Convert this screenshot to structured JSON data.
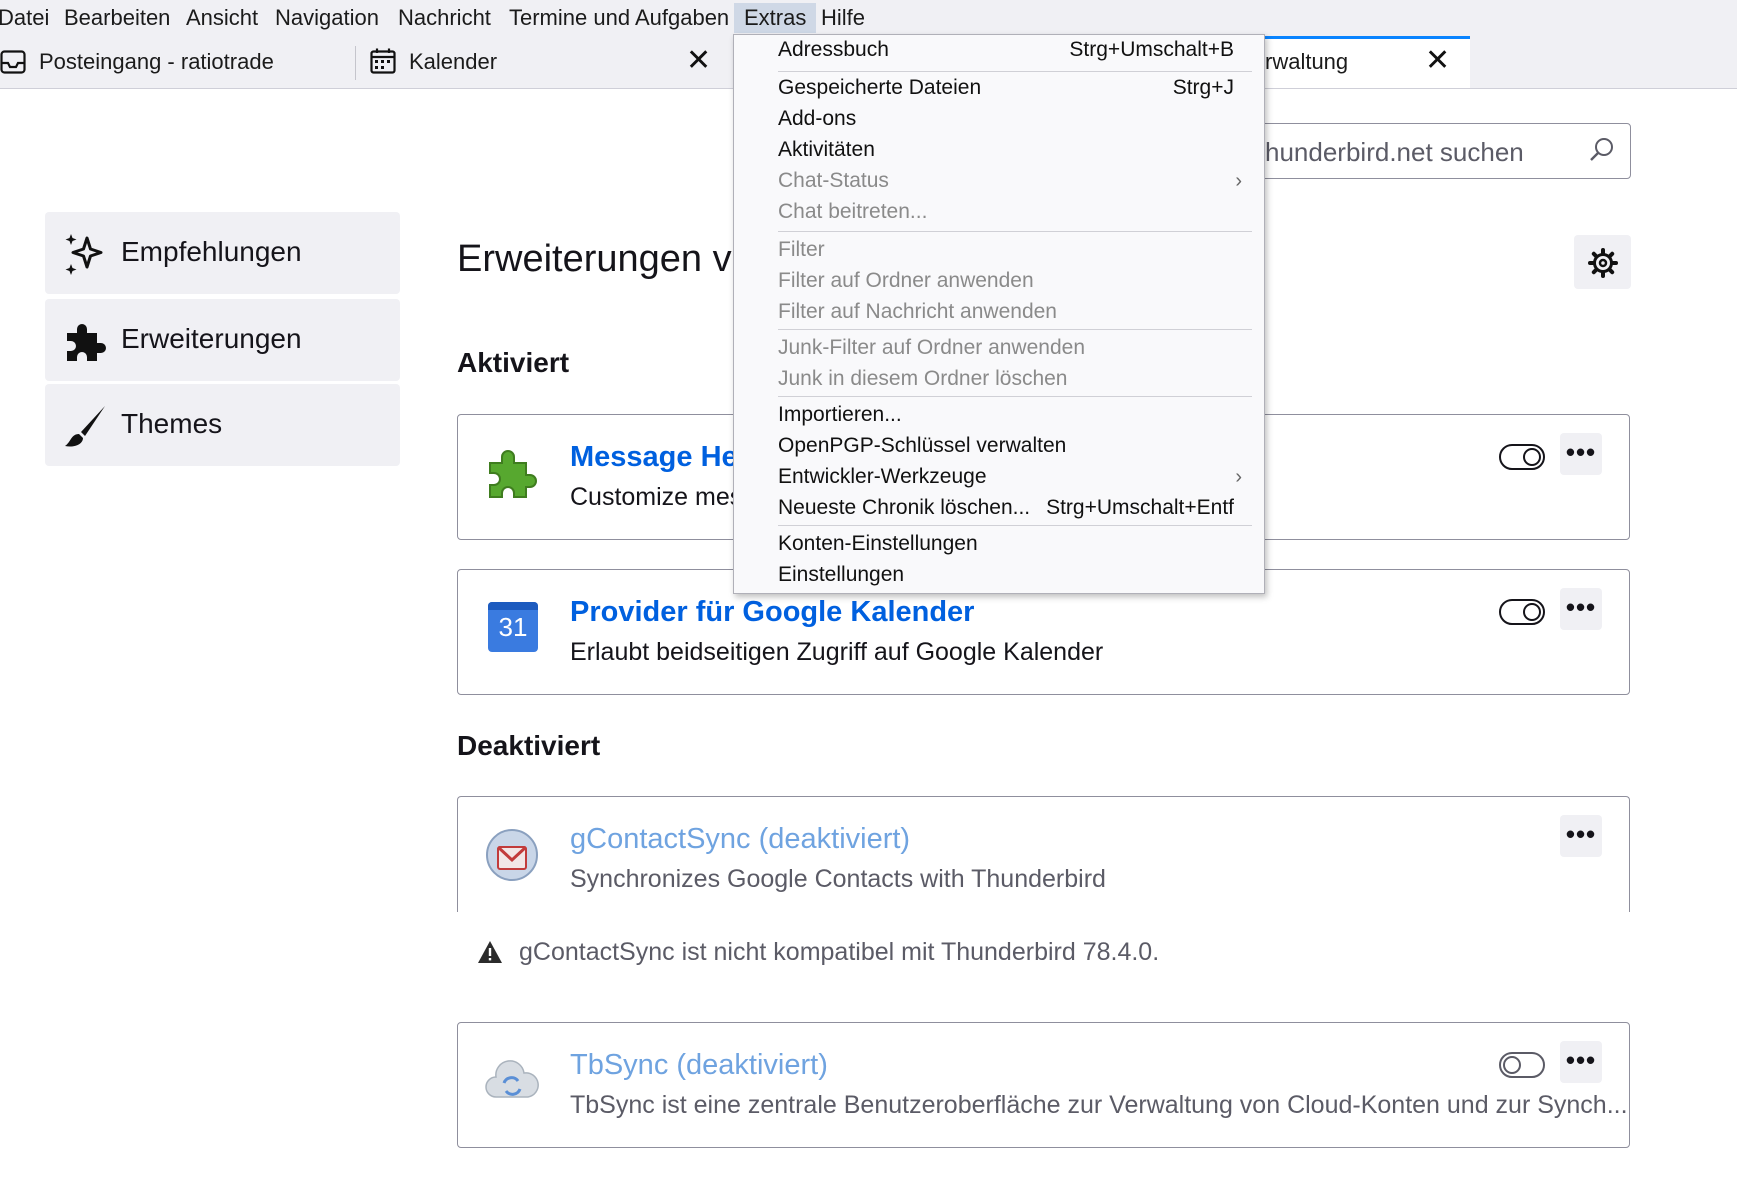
{
  "menubar": {
    "items": [
      "Datei",
      "Bearbeiten",
      "Ansicht",
      "Navigation",
      "Nachricht",
      "Termine und Aufgaben",
      "Extras",
      "Hilfe"
    ]
  },
  "tabs": [
    {
      "label": "Posteingang - ratiotrade",
      "icon": "inbox-icon"
    },
    {
      "label": "Kalender",
      "icon": "calendar-icon",
      "close": "✕"
    },
    {
      "label": "rwaltung",
      "icon": "addons-icon",
      "close": "✕"
    }
  ],
  "search": {
    "placeholder": "hunderbird.net suchen"
  },
  "sidebar": {
    "items": [
      {
        "label": "Empfehlungen",
        "icon": "sparkle-icon"
      },
      {
        "label": "Erweiterungen",
        "icon": "puzzle-icon"
      },
      {
        "label": "Themes",
        "icon": "brush-icon"
      }
    ]
  },
  "main": {
    "title": "Erweiterungen ve",
    "enabled_heading": "Aktiviert",
    "disabled_heading": "Deaktiviert",
    "more_label": "•••",
    "enabled": [
      {
        "name": "Message Hea",
        "desc": "Customize mes",
        "toggle": "on"
      },
      {
        "name": "Provider für Google Kalender",
        "desc": "Erlaubt beidseitigen Zugriff auf Google Kalender",
        "toggle": "on",
        "icon_text": "31"
      }
    ],
    "disabled": [
      {
        "name": "gContactSync (deaktiviert)",
        "desc": "Synchronizes Google Contacts with Thunderbird"
      },
      {
        "name": "TbSync (deaktiviert)",
        "desc": "TbSync ist eine zentrale Benutzeroberfläche zur Verwaltung von Cloud-Konten und zur Synch...",
        "toggle": "off"
      }
    ],
    "warning": "gContactSync ist nicht kompatibel mit Thunderbird 78.4.0."
  },
  "extras_menu": {
    "items": [
      {
        "label": "Adressbuch",
        "shortcut": "Strg+Umschalt+B",
        "enabled": true
      },
      {
        "label": "Gespeicherte Dateien",
        "shortcut": "Strg+J",
        "enabled": true
      },
      {
        "label": "Add-ons",
        "enabled": true
      },
      {
        "label": "Aktivitäten",
        "enabled": true
      },
      {
        "label": "Chat-Status",
        "enabled": false,
        "submenu": true
      },
      {
        "label": "Chat beitreten...",
        "enabled": false
      },
      {
        "label": "Filter",
        "enabled": false
      },
      {
        "label": "Filter auf Ordner anwenden",
        "enabled": false
      },
      {
        "label": "Filter auf Nachricht anwenden",
        "enabled": false
      },
      {
        "label": "Junk-Filter auf Ordner anwenden",
        "enabled": false
      },
      {
        "label": "Junk in diesem Ordner löschen",
        "enabled": false
      },
      {
        "label": "Importieren...",
        "enabled": true
      },
      {
        "label": "OpenPGP-Schlüssel verwalten",
        "enabled": true
      },
      {
        "label": "Entwickler-Werkzeuge",
        "enabled": true,
        "submenu": true
      },
      {
        "label": "Neueste Chronik löschen...",
        "shortcut": "Strg+Umschalt+Entf",
        "enabled": true
      },
      {
        "label": "Konten-Einstellungen",
        "enabled": true
      },
      {
        "label": "Einstellungen",
        "enabled": true
      }
    ],
    "submenu_arrow": "›"
  },
  "colors": {
    "link": "#0060df",
    "link_disabled": "#6fa3e0",
    "accent": "#0a84ff"
  }
}
